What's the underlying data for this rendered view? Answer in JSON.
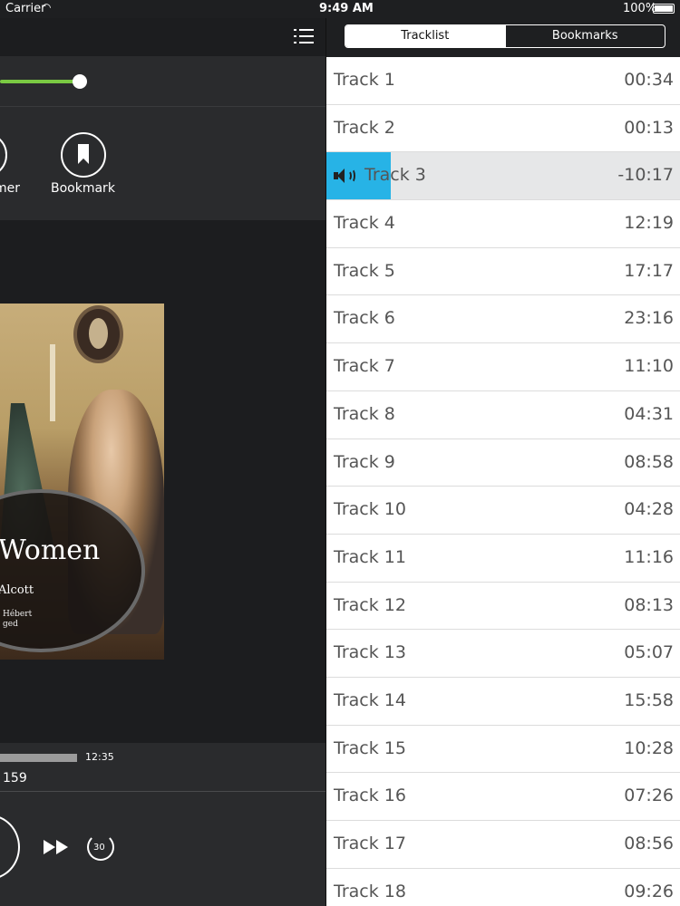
{
  "status_bar": {
    "carrier": "Carrier",
    "time": "9:49 AM",
    "battery": "100%"
  },
  "player": {
    "actions": {
      "timer_label": "Timer",
      "bookmark_label": "Bookmark"
    },
    "cover": {
      "title": "Women",
      "author": "Alcott",
      "narrator_line1": "Hébert",
      "narrator_line2": "ged"
    },
    "progress": {
      "elapsed_fraction": 0.25
    },
    "scrubber": {
      "duration": "12:35",
      "page": "159"
    },
    "skip_label": "30"
  },
  "tracklist": {
    "tabs": {
      "tracklist": "Tracklist",
      "bookmarks": "Bookmarks"
    },
    "active_tab": "Tracklist",
    "current_track": "Track 3",
    "tracks": [
      {
        "name": "Track 1",
        "time": "00:34"
      },
      {
        "name": "Track 2",
        "time": "00:13"
      },
      {
        "name": "Track 3",
        "time": "-10:17"
      },
      {
        "name": "Track 4",
        "time": "12:19"
      },
      {
        "name": "Track 5",
        "time": "17:17"
      },
      {
        "name": "Track 6",
        "time": "23:16"
      },
      {
        "name": "Track 7",
        "time": "11:10"
      },
      {
        "name": "Track 8",
        "time": "04:31"
      },
      {
        "name": "Track 9",
        "time": "08:58"
      },
      {
        "name": "Track 10",
        "time": "04:28"
      },
      {
        "name": "Track 11",
        "time": "11:16"
      },
      {
        "name": "Track 12",
        "time": "08:13"
      },
      {
        "name": "Track 13",
        "time": "05:07"
      },
      {
        "name": "Track 14",
        "time": "15:58"
      },
      {
        "name": "Track 15",
        "time": "10:28"
      },
      {
        "name": "Track 16",
        "time": "07:26"
      },
      {
        "name": "Track 17",
        "time": "08:56"
      },
      {
        "name": "Track 18",
        "time": "09:26"
      }
    ]
  },
  "colors": {
    "accent_green": "#7ac943",
    "current_blue": "#27b3e6",
    "panel_dark": "#1c1d1f"
  }
}
